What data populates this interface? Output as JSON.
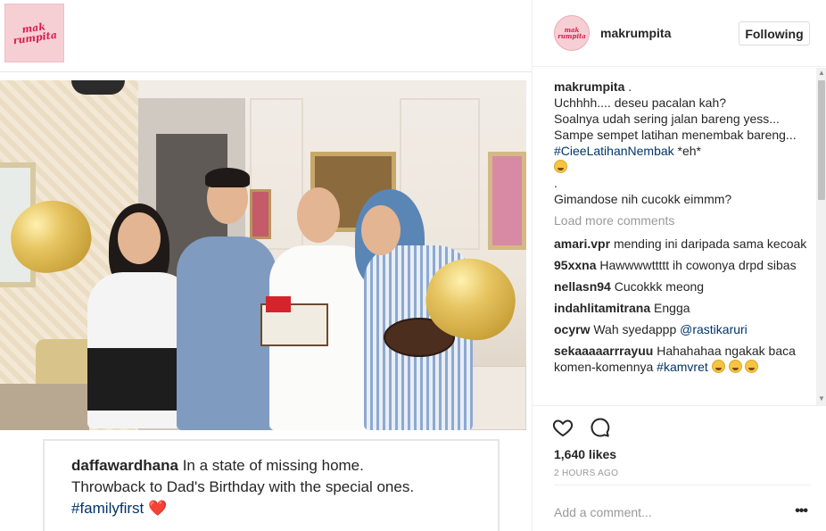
{
  "post_image": {
    "logo_text": "mak rumpita",
    "caption_card": {
      "user": "daffawardhana",
      "line1": " In a state of missing home.",
      "line2": "Throwback to Dad's Birthday with the special ones.",
      "hashtag": "#familyfirst",
      "heart": "❤️"
    }
  },
  "sidebar": {
    "header": {
      "avatar_text": "mak rumpita",
      "username": "makrumpita",
      "follow_label": "Following"
    },
    "caption": {
      "user": "makrumpita",
      "suffix": " .",
      "lines": [
        "Uchhhh.... deseu pacalan kah?",
        "Soalnya udah sering jalan bareng yess...",
        "Sampe sempet latihan menembak bareng..."
      ],
      "hashtag": "#CieeLatihanNembak",
      "after_hashtag": " *eh*",
      "dot": ".",
      "last_line": "Gimandose nih cucokk eimmm?"
    },
    "load_more": "Load more comments",
    "comments": [
      {
        "user": "amari.vpr",
        "text": "mending ini daripada sama kecoak"
      },
      {
        "user": "95xxna",
        "text": "Hawwwwttttt ih cowonya drpd sibas"
      },
      {
        "user": "nellasn94",
        "text": "Cucokkk meong"
      },
      {
        "user": "indahlitamitrana",
        "text": "Engga"
      },
      {
        "user": "ocyrw",
        "text": "Wah syedappp ",
        "tag": "@rastikaruri"
      },
      {
        "user": "sekaaaaarrrayuu",
        "text": "Hahahahaa ngakak baca komen-komennya ",
        "tag": "#kamvret"
      }
    ],
    "likes": "1,640 likes",
    "time": "2 HOURS AGO",
    "add_comment_placeholder": "Add a comment...",
    "more": "•••"
  },
  "icons": {
    "like": "heart-outline-icon",
    "comment": "speech-bubble-icon",
    "options": "ellipsis-icon"
  }
}
